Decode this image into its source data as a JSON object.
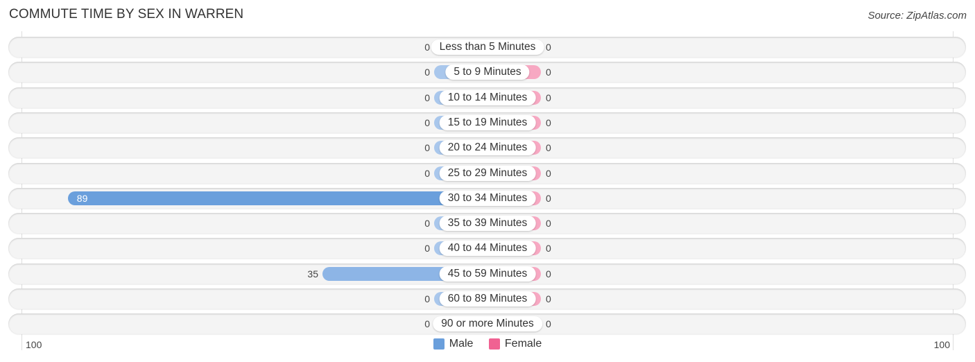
{
  "chart_data": {
    "type": "bar",
    "orientation": "horizontal-diverging",
    "title": "COMMUTE TIME BY SEX IN WARREN",
    "source": "Source: ZipAtlas.com",
    "categories": [
      "Less than 5 Minutes",
      "5 to 9 Minutes",
      "10 to 14 Minutes",
      "15 to 19 Minutes",
      "20 to 24 Minutes",
      "25 to 29 Minutes",
      "30 to 34 Minutes",
      "35 to 39 Minutes",
      "40 to 44 Minutes",
      "45 to 59 Minutes",
      "60 to 89 Minutes",
      "90 or more Minutes"
    ],
    "series": [
      {
        "name": "Male",
        "color": "#6a9fdc",
        "values": [
          0,
          0,
          0,
          0,
          0,
          0,
          89,
          0,
          0,
          35,
          0,
          0
        ]
      },
      {
        "name": "Female",
        "color": "#f06292",
        "values": [
          0,
          0,
          0,
          0,
          0,
          0,
          0,
          0,
          0,
          0,
          0,
          0
        ]
      }
    ],
    "xlim": [
      -100,
      100
    ],
    "axis_ticks": {
      "left": "100",
      "right": "100"
    },
    "legend": {
      "placement": "bottom-center",
      "entries": [
        "Male",
        "Female"
      ]
    },
    "colors": {
      "male_bar": "#6a9fdc",
      "male_bar_light": "#a9c7ec",
      "female_bar": "#f7a8c2",
      "female_swatch": "#f06292"
    }
  }
}
